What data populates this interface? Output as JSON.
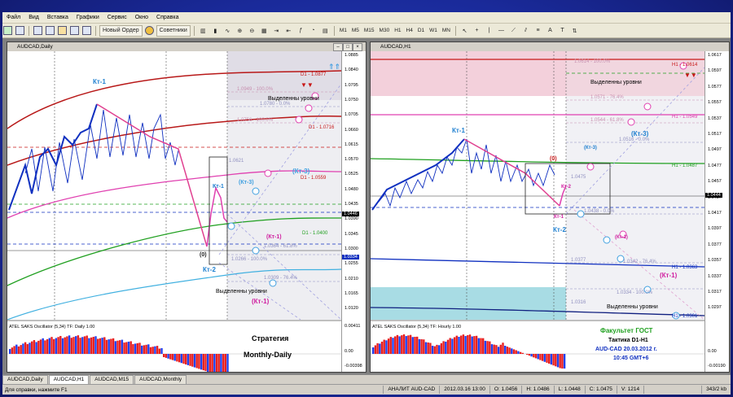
{
  "menu": [
    "Файл",
    "Вид",
    "Вставка",
    "Графики",
    "Сервис",
    "Окно",
    "Справка"
  ],
  "toolbar": {
    "new_order": "Новый Ордер",
    "experts": "Советники",
    "timeframes": [
      "M1",
      "M5",
      "M15",
      "M30",
      "H1",
      "H4",
      "D1",
      "W1",
      "MN"
    ]
  },
  "left_window": {
    "title": "AUDCAD,Daily",
    "scale": [
      "1.0885",
      "1.0840",
      "1.0795",
      "1.0750",
      "1.0705",
      "1.0660",
      "1.0615",
      "1.0570",
      "1.0525",
      "1.0480",
      "1.0435",
      "1.0390",
      "1.0345",
      "1.0300",
      "1.0255",
      "1.0210",
      "1.0165",
      "1.0120"
    ],
    "price_tag": "1.0446",
    "price_tag2": "1.0334",
    "osc_scale": [
      "0.00411",
      "0.00",
      "-0.00398"
    ],
    "labels": {
      "kt1_top": "Кт-1",
      "kt1_mid": "Кт-1",
      "kt2": "Кт-2",
      "kt3": "(Кт-3)",
      "kt3b": "(Кт-3)",
      "kt1_pink": "(Кт-1)",
      "kt1_pink2": "(Кт-1)",
      "zero": "(0)",
      "levels1": "Выделенны уровни",
      "levels2": "Выделенны уровни",
      "d1_0877": "D1 - 1.0877",
      "d1_0716": "D1 - 1.0716",
      "d1_0559": "D1 - 1.0559",
      "d1_0400": "D1 - 1.0400",
      "f0780": "1.0780 - 0.0%",
      "f0949": "1.0949 - 100.0%",
      "f0756": "1.0756 - 100.0%",
      "f0621": "1.0621",
      "f0364": "1.0364 - 61.8%",
      "f0266": "1.0266 - 100.0%",
      "f0309": "1.0309 - 76.4%",
      "osc_name": "ATEL SAKS Oscillator (5,34) TF: Daily 1.00",
      "strategy1": "Стратегия",
      "strategy2": "Monthly-Daily"
    }
  },
  "right_window": {
    "title": "AUDCAD,H1",
    "scale": [
      "1.0617",
      "1.0597",
      "1.0577",
      "1.0557",
      "1.0537",
      "1.0517",
      "1.0497",
      "1.0477",
      "1.0457",
      "1.0437",
      "1.0417",
      "1.0397",
      "1.0377",
      "1.0357",
      "1.0337",
      "1.0317",
      "1.0297"
    ],
    "price_tag": "1.0444",
    "osc_scale": [
      "0.00",
      "-0.00190"
    ],
    "labels": {
      "kt1": "Кт-1",
      "kt1_small": "Кт-1",
      "kt2": "Кт-2",
      "kt2b": "Кт-2",
      "kt3": "(Кт-3)",
      "kt3b": "(Кт-3)",
      "kt1_pink": "(Кт-1)",
      "kt1_pink2": "(Кт-1)",
      "zero": "(0)",
      "levels1": "Выделенны уровни",
      "levels2": "Выделенны уровни",
      "h1_0614": "H1 - 1.0614",
      "h1_0549": "H1 - 1.0549",
      "h1_0487": "H1 - 1.0487",
      "h1_0363": "H1 - 1.0363",
      "h1_0301": "H1 - 1.0301",
      "f0614": "1.0614 - 100.0%",
      "f0571": "1.0571 - 76.4%",
      "f0544": "1.0544 - 61.8%",
      "f0516": "1.0516 - 0.0%",
      "f0475": "1.0475",
      "f0438": "1.0438 - 0.0%",
      "f0377": "1.0377",
      "f0342": "1.0342 - 76.4%",
      "f0334": "1.0334 - 100.0%",
      "f0316": "1.0316",
      "osc_name": "ATEL SAKS Oscillator (5,34) TF: Hourly 1.00",
      "gost1": "Факультет ГОСТ",
      "gost2": "Тактика D1-H1",
      "gost3": "AUD-CAD 20.03.2012 г.",
      "gost4": "10:45 GMT+6"
    }
  },
  "tabs": [
    "AUDCAD,Daily",
    "AUDCAD,H1",
    "AUDCAD,M15",
    "AUDCAD,Monthly"
  ],
  "status": {
    "help": "Для справки, нажмите F1",
    "profile": "АНАЛИТ AUD-CAD",
    "time": "2012.03.16 13:00",
    "open": "O: 1.0456",
    "high": "H: 1.0486",
    "low": "L: 1.0448",
    "close": "C: 1.0475",
    "volume": "V: 1214",
    "traffic": "343/2 kb"
  },
  "colors": {
    "bg": "#1a2a9a",
    "blue_line": "#1030c0",
    "pink": "#e040b0",
    "red": "#c81818",
    "green": "#20a020",
    "cyan": "#40b0e0",
    "osc_red": "#e82020",
    "osc_blue": "#2040f0"
  }
}
